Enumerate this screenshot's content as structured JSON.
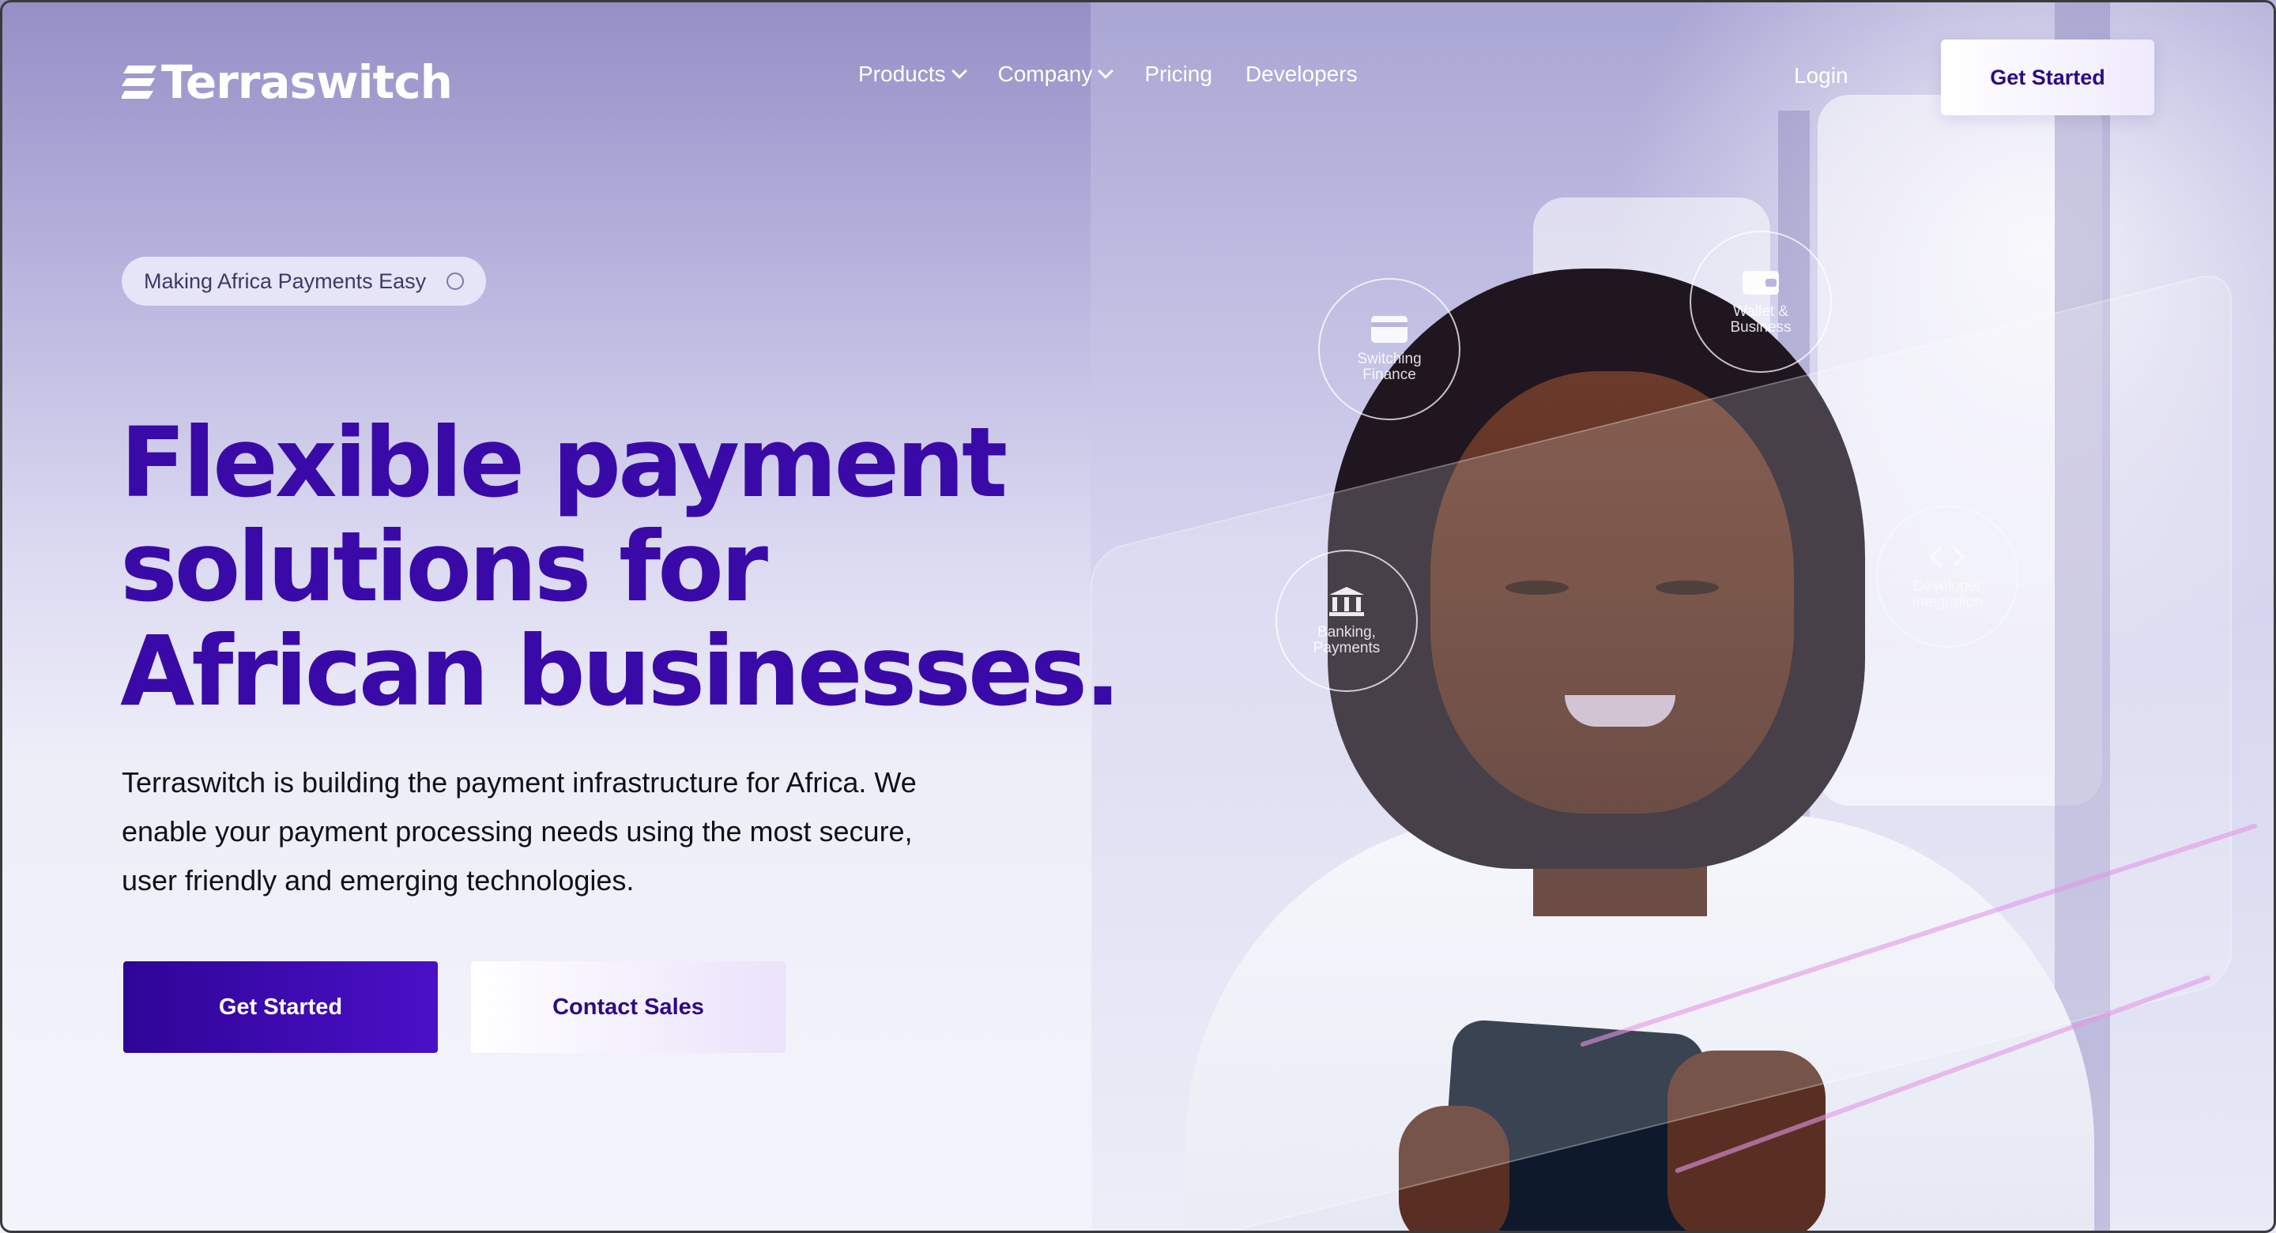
{
  "brand": {
    "name": "Terraswitch",
    "logo_icon": "stacked-bars-logo-icon"
  },
  "nav": {
    "items": [
      {
        "label": "Products",
        "has_dropdown": true
      },
      {
        "label": "Company",
        "has_dropdown": true
      },
      {
        "label": "Pricing",
        "has_dropdown": false
      },
      {
        "label": "Developers",
        "has_dropdown": false
      }
    ],
    "login": "Login",
    "cta": "Get Started"
  },
  "hero": {
    "badge": "Making Africa Payments Easy",
    "headline": "Flexible payment solutions for African businesses.",
    "description": "Terraswitch is building the payment infrastructure for Africa. We enable your payment processing needs using the most secure, user friendly and emerging technologies.",
    "primary_cta": "Get Started",
    "secondary_cta": "Contact Sales"
  },
  "orbit_labels": [
    {
      "line1": "Switching",
      "line2": "Finance",
      "icon": "card-icon"
    },
    {
      "line1": "Wallet &",
      "line2": "Business",
      "icon": "wallet-icon"
    },
    {
      "line1": "Banking,",
      "line2": "Payments",
      "icon": "bank-icon"
    },
    {
      "line1": "Developer",
      "line2": "Integration",
      "icon": "code-icon"
    }
  ],
  "colors": {
    "brand_purple": "#3a0aa8",
    "button_purple": "#4a10c8",
    "background_lavender": "#b8b4de"
  }
}
